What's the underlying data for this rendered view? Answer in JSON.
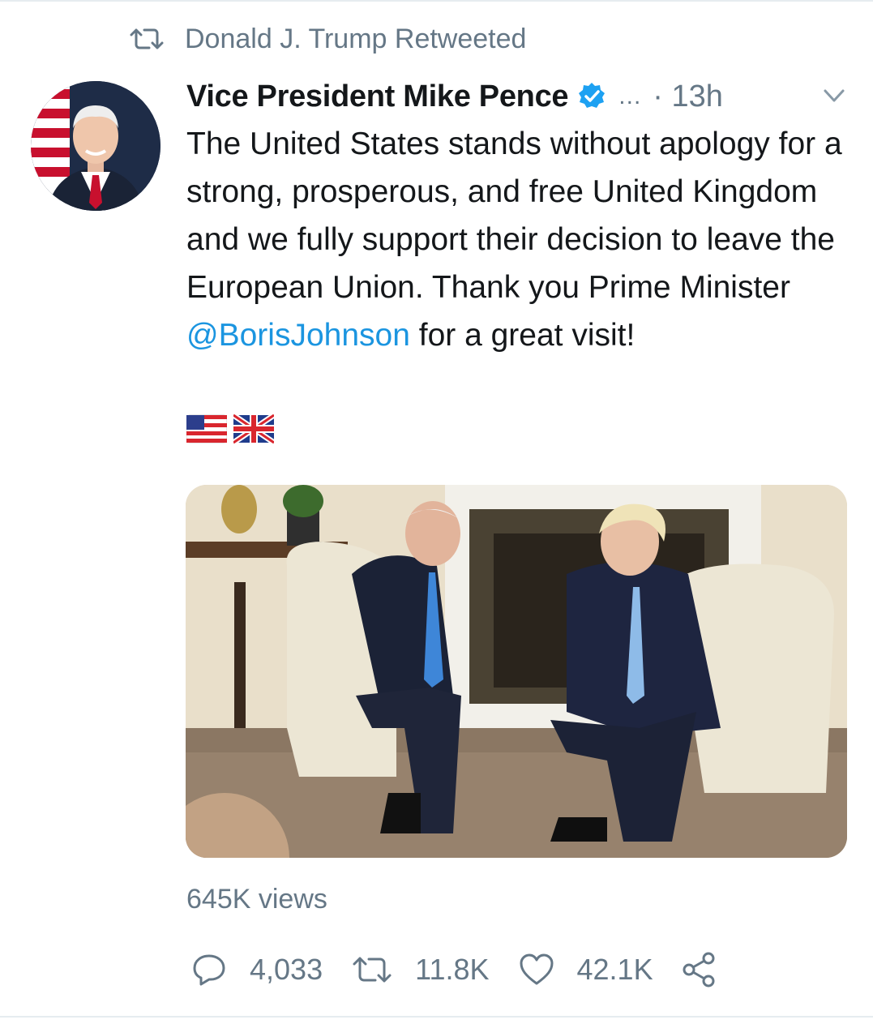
{
  "retweet_banner": {
    "text": "Donald J. Trump Retweeted",
    "icon": "retweet-icon"
  },
  "tweet": {
    "display_name": "Vice President Mike Pence",
    "verified_icon": "verified-badge-icon",
    "handle_truncated": "...",
    "time_sep": "·",
    "time": "13h",
    "text_before": "The United States stands without apology for a strong, prosperous, and free United Kingdom and we fully support their decision to leave the European Union. Thank you Prime Minister ",
    "mention": "@BorisJohnson",
    "text_after": " for a great visit!",
    "emoji": [
      "us-flag-emoji",
      "uk-flag-emoji"
    ]
  },
  "media": {
    "type": "video-thumbnail",
    "icon": "video-thumbnail"
  },
  "views": "645K views",
  "actions": {
    "reply_count": "4,033",
    "retweet_count": "11.8K",
    "like_count": "42.1K"
  },
  "colors": {
    "accent": "#1b95e0",
    "muted": "#657786",
    "text": "#14171a",
    "verified": "#1da1f2"
  }
}
